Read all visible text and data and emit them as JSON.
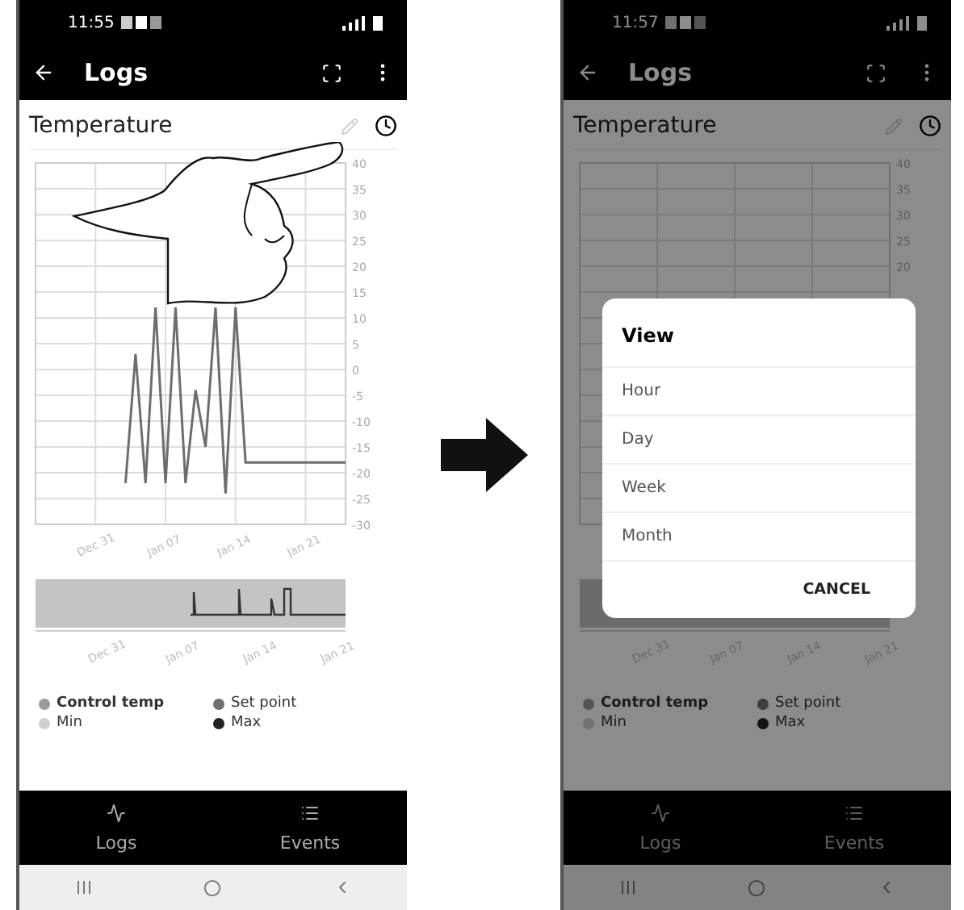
{
  "screens": [
    {
      "status_bar": {
        "time": "11:55"
      },
      "app_bar": {
        "title": "Logs"
      },
      "pointer_hand": true,
      "card": {
        "title": "Temperature",
        "chart": {
          "chart_data": {
            "type": "line",
            "grid": true,
            "ylim": [
              -30,
              40
            ],
            "categories": [
              null,
              null,
              null,
              null,
              null,
              null,
              "Dec 31",
              null,
              null,
              null,
              null,
              null,
              null,
              "Jan 07",
              null,
              null,
              null,
              null,
              null,
              null,
              "Jan 14",
              null,
              null,
              null,
              null,
              null,
              null,
              "Jan 21",
              null,
              null,
              null,
              null
            ],
            "yticks": [
              40,
              35,
              30,
              25,
              20,
              15,
              10,
              5,
              0,
              -5,
              -10,
              -15,
              -20,
              -25,
              {
                "value": -30,
                "label": "-30"
              }
            ],
            "series": [
              {
                "color": "#6e6e6e",
                "values": [
                  null,
                  null,
                  null,
                  null,
                  null,
                  null,
                  null,
                  null,
                  null,
                  -22,
                  3,
                  -22,
                  12,
                  -22,
                  12,
                  -22,
                  -4,
                  -15,
                  12,
                  -24,
                  12,
                  -18,
                  -18,
                  -18,
                  -18,
                  -18,
                  -18,
                  -18,
                  -18,
                  -18,
                  -18,
                  -18
                ]
              }
            ]
          }
        },
        "navigator": {
          "labels": [
            "Dec 31",
            "Jan 07",
            "Jan 14",
            "Jan 21"
          ]
        }
      },
      "legend": [
        {
          "label": "Control temp",
          "color": "#9a9a9a",
          "selected": true
        },
        {
          "label": "Set point",
          "color": "#707070",
          "selected": false
        },
        {
          "label": "Min",
          "color": "#d0d0d0",
          "selected": false
        },
        {
          "label": "Max",
          "color": "#222222",
          "selected": false
        }
      ],
      "bottom_nav": [
        {
          "label": "Logs",
          "kind": "chart"
        },
        {
          "label": "Events",
          "kind": "list"
        }
      ]
    },
    {
      "status_bar": {
        "time": "11:57"
      },
      "app_bar": {
        "title": "Logs"
      },
      "pointer_hand": false,
      "card": {
        "title": "Temperature",
        "chart": {
          "y_axis_labels": [
            "40",
            "35",
            "30",
            "25",
            "20"
          ]
        },
        "navigator": {
          "labels": [
            "Dec 31",
            "Jan 07",
            "Jan 14",
            "Jan 21"
          ]
        }
      },
      "legend": [
        {
          "label": "Control temp",
          "color": "#555555",
          "selected": true
        },
        {
          "label": "Set point",
          "color": "#3e3e3e",
          "selected": false
        },
        {
          "label": "Min",
          "color": "#727272",
          "selected": false
        },
        {
          "label": "Max",
          "color": "#131313",
          "selected": false
        }
      ],
      "bottom_nav": [
        {
          "label": "Logs",
          "kind": "chart"
        },
        {
          "label": "Events",
          "kind": "list"
        }
      ],
      "dialog": {
        "title": "View",
        "options": [
          "Hour",
          "Day",
          "Week",
          "Month"
        ],
        "button": "CANCEL"
      }
    }
  ]
}
